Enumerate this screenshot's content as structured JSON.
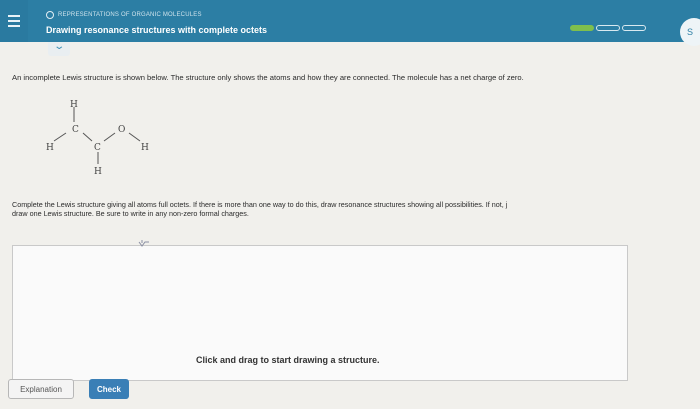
{
  "header": {
    "breadcrumb": "REPRESENTATIONS OF ORGANIC MOLECULES",
    "title": "Drawing resonance structures with complete octets",
    "progress": {
      "filled_segments": 1,
      "total_segments": 3
    },
    "user_initial": "S"
  },
  "question": {
    "prompt": "An incomplete Lewis structure is shown below. The structure only shows the atoms and how they are connected. The molecule has a net charge of zero.",
    "instructions_line1": "Complete the Lewis structure giving all atoms full octets. If there is more than one way to do this, draw resonance structures showing all possibilities. If not, j",
    "instructions_line2": "draw one Lewis structure. Be sure to write in any non-zero formal charges."
  },
  "molecule": {
    "atoms": {
      "h_top": "H",
      "c1": "C",
      "o": "O",
      "h_left": "H",
      "c2": "C",
      "h_right": "H",
      "h_bottom": "H"
    }
  },
  "canvas": {
    "hint": "Click and drag to start drawing a structure."
  },
  "buttons": {
    "explanation": "Explanation",
    "check": "Check"
  },
  "colors": {
    "header_bg": "#2c7ea4",
    "progress_fill": "#7fbf4d",
    "check_button": "#3a7fb6"
  }
}
